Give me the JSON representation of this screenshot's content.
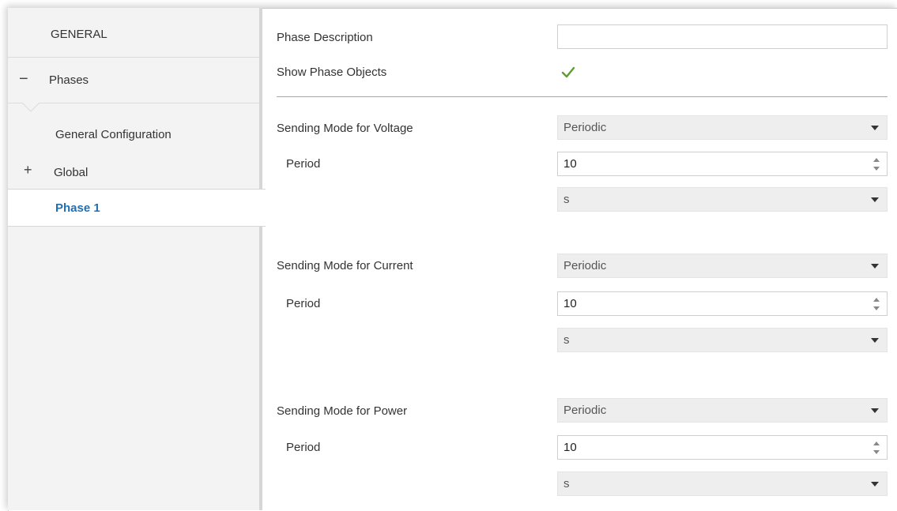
{
  "sidebar": {
    "general_label": "GENERAL",
    "phases_symbol": "−",
    "phases_label": "Phases",
    "general_configuration_label": "General Configuration",
    "global_symbol": "+",
    "global_label": "Global",
    "phase1_label": "Phase 1"
  },
  "main": {
    "phase_description_label": "Phase Description",
    "phase_description_value": "",
    "show_phase_objects_label": "Show Phase Objects",
    "show_phase_objects_checked": true,
    "voltage": {
      "mode_label": "Sending Mode for Voltage",
      "mode_value": "Periodic",
      "period_label": "Period",
      "period_value": "10",
      "unit_value": "s"
    },
    "current": {
      "mode_label": "Sending Mode for Current",
      "mode_value": "Periodic",
      "period_label": "Period",
      "period_value": "10",
      "unit_value": "s"
    },
    "power": {
      "mode_label": "Sending Mode for Power",
      "mode_value": "Periodic",
      "period_label": "Period",
      "period_value": "10",
      "unit_value": "s"
    }
  },
  "colors": {
    "accent": "#1f6fb5",
    "check": "#5aa02c",
    "sidebar_bg": "#f3f3f3"
  },
  "icons": {
    "collapse": "minus-icon",
    "expand": "plus-icon",
    "check": "checkmark-icon",
    "dropdown": "caret-down-icon",
    "spinner": "spinner-arrows-icon"
  }
}
